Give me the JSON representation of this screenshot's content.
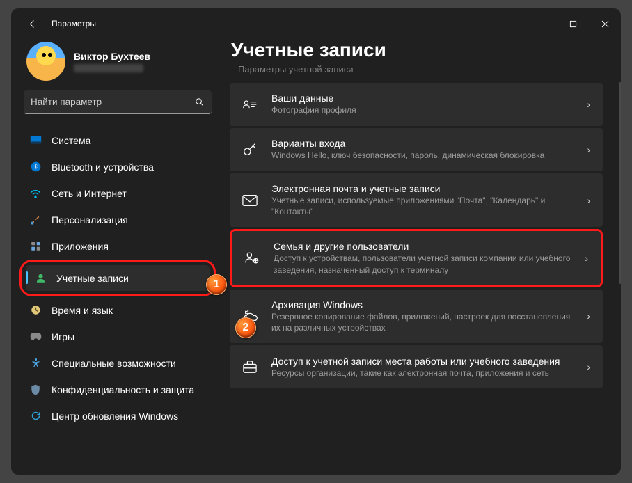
{
  "window": {
    "title": "Параметры"
  },
  "profile": {
    "name": "Виктор Бухтеев"
  },
  "search": {
    "placeholder": "Найти параметр"
  },
  "nav": {
    "items": [
      {
        "label": "Система"
      },
      {
        "label": "Bluetooth и устройства"
      },
      {
        "label": "Сеть и Интернет"
      },
      {
        "label": "Персонализация"
      },
      {
        "label": "Приложения"
      },
      {
        "label": "Учетные записи"
      },
      {
        "label": "Время и язык"
      },
      {
        "label": "Игры"
      },
      {
        "label": "Специальные возможности"
      },
      {
        "label": "Конфиденциальность и защита"
      },
      {
        "label": "Центр обновления Windows"
      }
    ]
  },
  "page": {
    "title": "Учетные записи",
    "section_label": "Параметры учетной записи"
  },
  "cards": [
    {
      "title": "Ваши данные",
      "sub": "Фотография профиля"
    },
    {
      "title": "Варианты входа",
      "sub": "Windows Hello, ключ безопасности, пароль, динамическая блокировка"
    },
    {
      "title": "Электронная почта и учетные записи",
      "sub": "Учетные записи, используемые приложениями \"Почта\", \"Календарь\" и \"Контакты\""
    },
    {
      "title": "Семья и другие пользователи",
      "sub": "Доступ к устройствам, пользователи учетной записи компании или учебного заведения, назначенный доступ к терминалу"
    },
    {
      "title": "Архивация Windows",
      "sub": "Резервное копирование файлов, приложений, настроек для восстановления их на различных устройствах"
    },
    {
      "title": "Доступ к учетной записи места работы или учебного заведения",
      "sub": "Ресурсы организации, такие как электронная почта, приложения и сеть"
    }
  ],
  "badges": {
    "one": "1",
    "two": "2"
  }
}
